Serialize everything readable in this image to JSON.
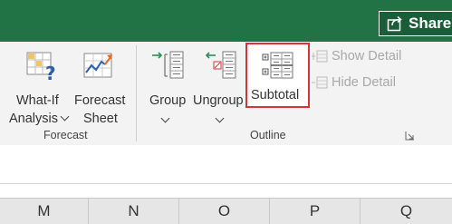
{
  "titlebar": {
    "share_label": "Share",
    "accent": "#217346"
  },
  "ribbon": {
    "forecast_group": {
      "label": "Forecast",
      "whatif": {
        "line1": "What-If",
        "line2": "Analysis",
        "icon": "what-if-analysis-icon"
      },
      "forecast_sheet": {
        "line1": "Forecast",
        "line2": "Sheet",
        "icon": "forecast-sheet-icon"
      }
    },
    "outline_group": {
      "label": "Outline",
      "group_btn": {
        "label": "Group",
        "icon": "group-icon"
      },
      "ungroup_btn": {
        "label": "Ungroup",
        "icon": "ungroup-icon"
      },
      "subtotal_btn": {
        "label": "Subtotal",
        "icon": "subtotal-icon"
      },
      "show_detail": {
        "label": "Show Detail",
        "icon": "show-detail-icon"
      },
      "hide_detail": {
        "label": "Hide Detail",
        "icon": "hide-detail-icon"
      }
    }
  },
  "columns": [
    "M",
    "N",
    "O",
    "P",
    "Q"
  ],
  "colors": {
    "highlight_border": "#d9333a",
    "disabled_text": "#a8a8a8"
  }
}
